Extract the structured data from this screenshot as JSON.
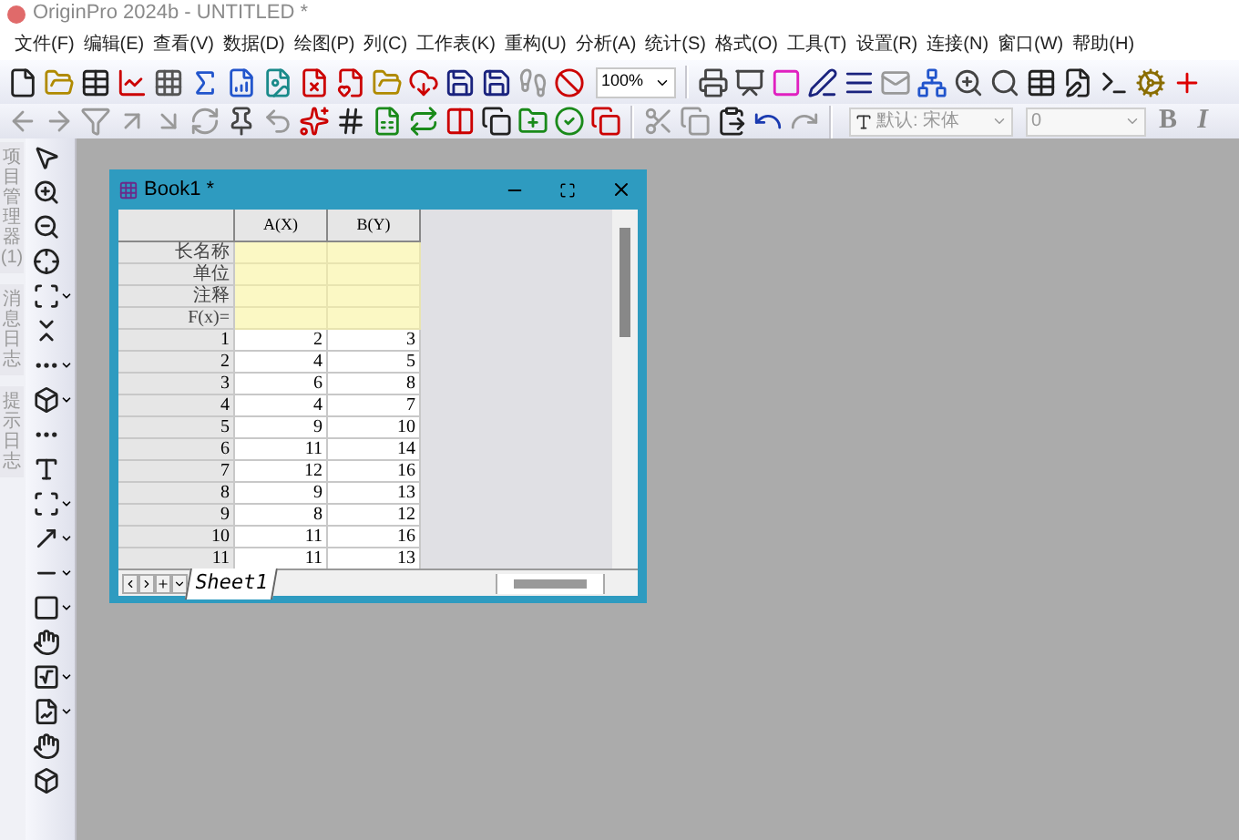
{
  "app": {
    "title": "OriginPro 2024b - UNTITLED *"
  },
  "menu": [
    "文件(F)",
    "编辑(E)",
    "查看(V)",
    "数据(D)",
    "绘图(P)",
    "列(C)",
    "工作表(K)",
    "重构(U)",
    "分析(A)",
    "统计(S)",
    "格式(O)",
    "工具(T)",
    "设置(R)",
    "连接(N)",
    "窗口(W)",
    "帮助(H)"
  ],
  "toolbar": {
    "zoom": "100%",
    "font": "默认: 宋体",
    "font_size": "0",
    "bold": "B",
    "italic": "I"
  },
  "side_tabs": [
    "项目管理器 (1)",
    "消息日志",
    "提示日志"
  ],
  "workbook": {
    "title": "Book1 *",
    "columns": [
      "A(X)",
      "B(Y)"
    ],
    "label_rows": [
      "长名称",
      "单位",
      "注释",
      "F(x)="
    ],
    "rows": [
      [
        "1",
        "2",
        "3"
      ],
      [
        "2",
        "4",
        "5"
      ],
      [
        "3",
        "6",
        "8"
      ],
      [
        "4",
        "4",
        "7"
      ],
      [
        "5",
        "9",
        "10"
      ],
      [
        "6",
        "11",
        "14"
      ],
      [
        "7",
        "12",
        "16"
      ],
      [
        "8",
        "9",
        "13"
      ],
      [
        "9",
        "8",
        "12"
      ],
      [
        "10",
        "11",
        "16"
      ],
      [
        "11",
        "11",
        "13"
      ]
    ],
    "sheet_tab": "Sheet1"
  }
}
